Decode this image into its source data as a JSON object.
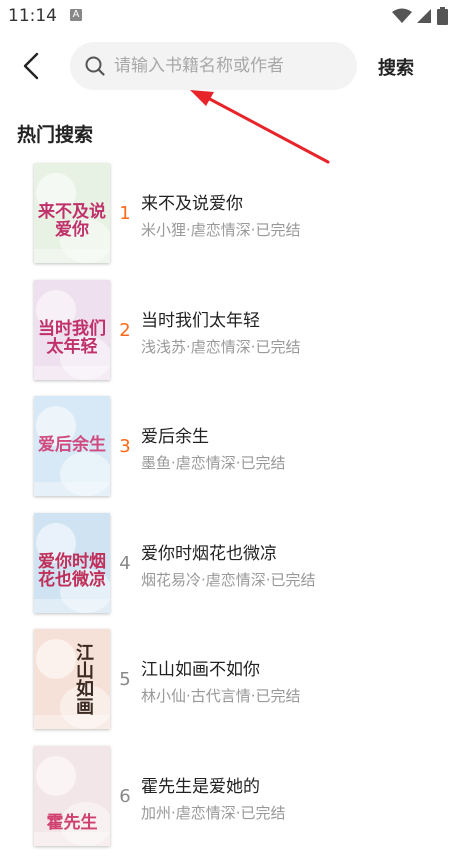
{
  "status": {
    "time": "11:14",
    "notif_glyph": "A"
  },
  "search": {
    "placeholder": "请输入书籍名称或作者",
    "button_label": "搜索"
  },
  "section": {
    "title": "热门搜索"
  },
  "books": [
    {
      "rank": "1",
      "name": "来不及说爱你",
      "meta": "米小狸·虐恋情深·已完结",
      "cover_text": "来不及说爱你",
      "hot": true,
      "cover_bg": "#e8f2e4",
      "cover_accent": "#c0306a"
    },
    {
      "rank": "2",
      "name": "当时我们太年轻",
      "meta": "浅浅苏·虐恋情深·已完结",
      "cover_text": "当时我们太年轻",
      "hot": true,
      "cover_bg": "#eee0ee",
      "cover_accent": "#c0306a"
    },
    {
      "rank": "3",
      "name": "爱后余生",
      "meta": "墨鱼·虐恋情深·已完结",
      "cover_text": "爱后余生",
      "hot": true,
      "cover_bg": "#d7e9f6",
      "cover_accent": "#d04a80"
    },
    {
      "rank": "4",
      "name": "爱你时烟花也微凉",
      "meta": "烟花易冷·虐恋情深·已完结",
      "cover_text": "爱你时烟花也微凉",
      "hot": false,
      "cover_bg": "#cfe3f3",
      "cover_accent": "#c0305a"
    },
    {
      "rank": "5",
      "name": "江山如画不如你",
      "meta": "林小仙·古代言情·已完结",
      "cover_text": "江山如画",
      "hot": false,
      "cover_bg": "#f6e1d8",
      "cover_accent": "#3b2a22"
    },
    {
      "rank": "6",
      "name": "霍先生是爱她的",
      "meta": "加州·虐恋情深·已完结",
      "cover_text": "霍先生",
      "hot": false,
      "cover_bg": "#f3e6e8",
      "cover_accent": "#d04070"
    }
  ]
}
